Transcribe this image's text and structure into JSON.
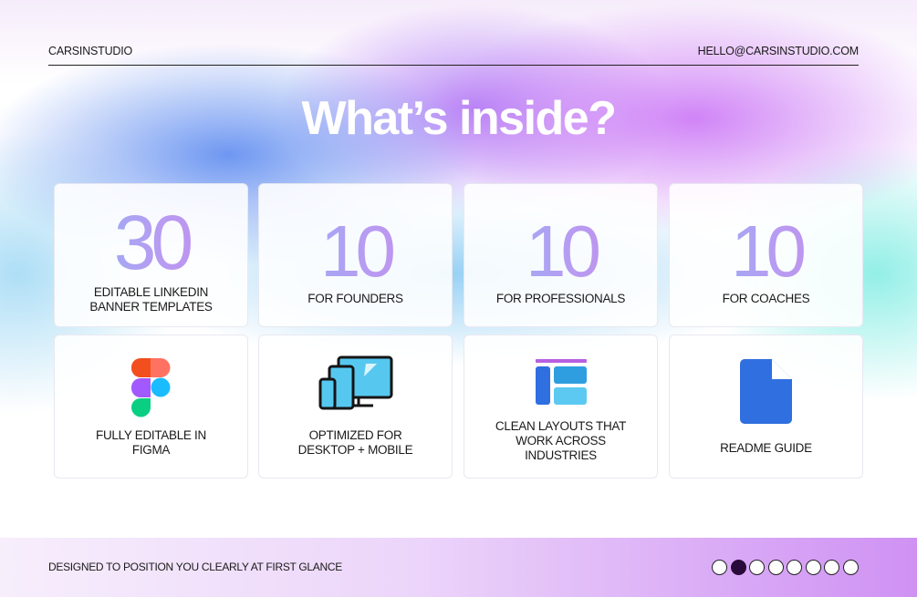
{
  "header": {
    "brand": "CARSINSTUDIO",
    "email": "HELLO@CARSINSTUDIO.COM"
  },
  "title": "What’s inside?",
  "stats": [
    {
      "number": "30",
      "label_line1": "EDITABLE LINKEDIN",
      "label_line2": "BANNER TEMPLATES"
    },
    {
      "number": "10",
      "label_line1": "FOR FOUNDERS"
    },
    {
      "number": "10",
      "label_line1": "FOR PROFESSIONALS"
    },
    {
      "number": "10",
      "label_line1": "FOR COACHES"
    }
  ],
  "features": [
    {
      "icon": "figma-icon",
      "label_line1": "FULLY EDITABLE IN",
      "label_line2": "FIGMA"
    },
    {
      "icon": "devices-icon",
      "label_line1": "OPTIMIZED FOR",
      "label_line2": "DESKTOP + MOBILE"
    },
    {
      "icon": "layout-icon",
      "label_line1": "CLEAN LAYOUTS THAT",
      "label_line2": "WORK ACROSS",
      "label_line3": "INDUSTRIES"
    },
    {
      "icon": "document-icon",
      "label_line1": "README GUIDE"
    }
  ],
  "footer": {
    "tagline": "DESIGNED TO POSITION YOU CLEARLY AT FIRST GLANCE",
    "pagination": {
      "total": 8,
      "active": 2
    }
  },
  "colors": {
    "accent_purple": "#c98ae8",
    "accent_blue": "#5fa0f0",
    "active_dot": "#2a0a3a",
    "icon_blue": "#2f6fe0"
  }
}
